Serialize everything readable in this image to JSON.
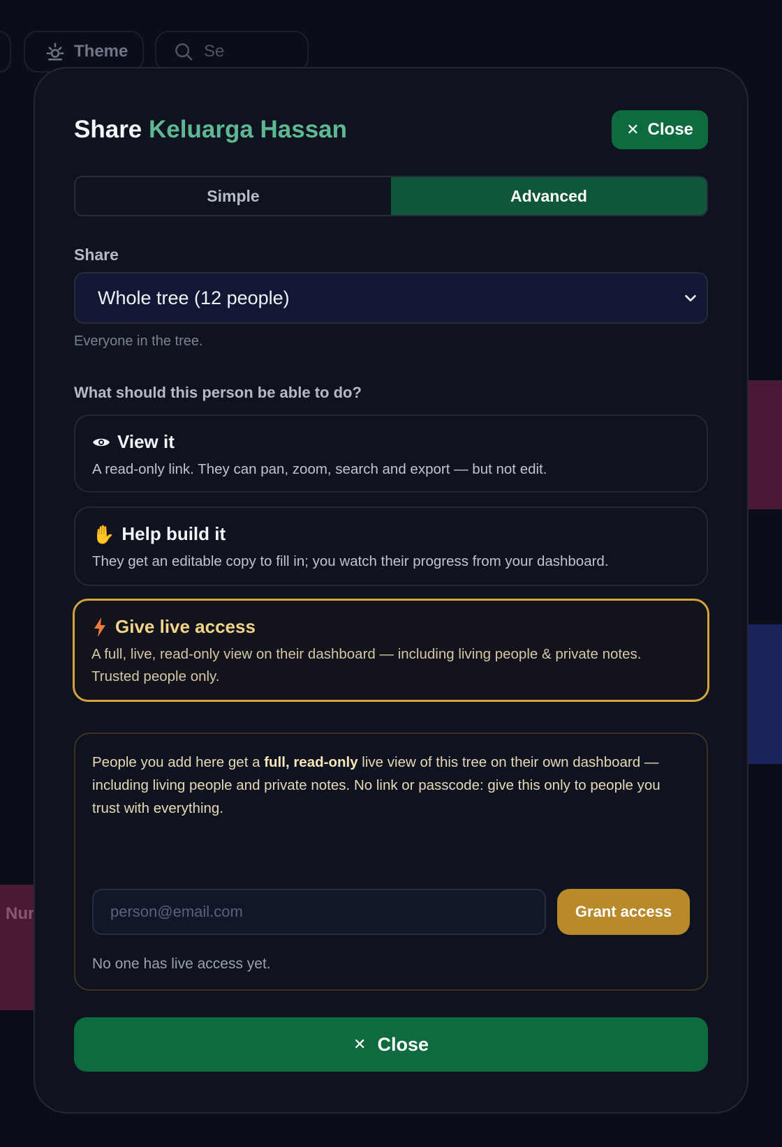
{
  "background": {
    "theme_label": "Theme",
    "search_placeholder": "Se",
    "left_card_text": "Nur"
  },
  "modal": {
    "title_prefix": "Share",
    "tree_name": "Keluarga Hassan",
    "close_label": "Close",
    "tabs": [
      {
        "label": "Simple",
        "active": false
      },
      {
        "label": "Advanced",
        "active": true
      }
    ],
    "share_label": "Share",
    "share_select_value": "Whole tree (12 people)",
    "share_hint": "Everyone in the tree.",
    "question": "What should this person be able to do?",
    "options": [
      {
        "icon": "eye-icon",
        "title": "View it",
        "description": "A read-only link. They can pan, zoom, search and export — but not edit.",
        "selected": false
      },
      {
        "icon": "raised-hand-icon",
        "title": "Help build it",
        "description": "They get an editable copy to fill in; you watch their progress from your dashboard.",
        "selected": false
      },
      {
        "icon": "lightning-icon",
        "title": "Give live access",
        "description": "A full, live, read-only view on their dashboard — including living people & private notes. Trusted people only.",
        "selected": true
      }
    ],
    "live_panel": {
      "text_before": "People you add here get a ",
      "text_bold": "full, read-only",
      "text_after": " live view of this tree on their own dashboard — including living people and private notes. No link or passcode: give this only to people you trust with everything.",
      "email_placeholder": "person@email.com",
      "grant_label": "Grant access",
      "empty_state": "No one has live access yet."
    },
    "bottom_close_label": "Close"
  },
  "colors": {
    "accent_green": "#0d6b3f",
    "tree_name_green": "#5fb892",
    "live_gold": "#d2a43c",
    "grant_gold": "#b98a2a"
  }
}
